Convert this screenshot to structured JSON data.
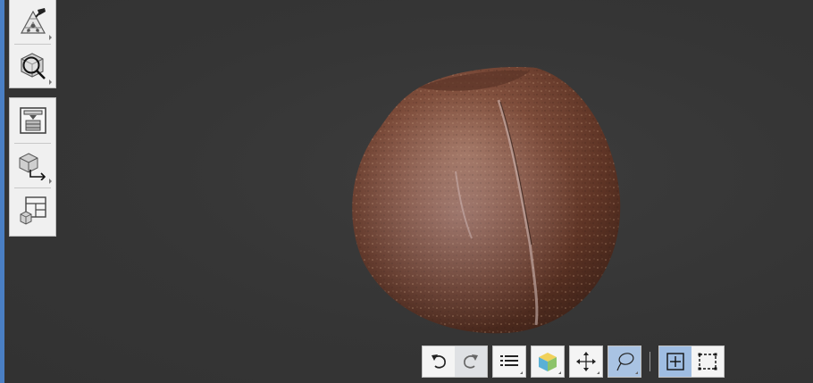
{
  "app": {
    "accent_color": "#4a7fc4",
    "viewport_background": "#353535"
  },
  "left_toolbar": {
    "panel_top": [
      {
        "icon": "mesh-paint-icon",
        "has_submenu": true
      },
      {
        "icon": "inspect-zoom-icon",
        "has_submenu": true
      }
    ],
    "panel_bottom": [
      {
        "icon": "print-layers-icon",
        "has_submenu": false
      },
      {
        "icon": "export-model-icon",
        "has_submenu": true
      },
      {
        "icon": "layout-view-icon",
        "has_submenu": false
      }
    ]
  },
  "viewport": {
    "object": "coconut-3d-model"
  },
  "bottom_toolbar": {
    "undo": {
      "icon": "undo-icon"
    },
    "redo": {
      "icon": "redo-icon",
      "state": "pressed"
    },
    "object_list": {
      "icon": "list-icon",
      "has_submenu": true
    },
    "shading": {
      "icon": "shaded-cube-icon",
      "has_submenu": true
    },
    "move": {
      "icon": "move-arrows-icon",
      "has_submenu": true
    },
    "lasso": {
      "icon": "lasso-icon",
      "state": "active",
      "has_submenu": true
    },
    "select_add": {
      "icon": "select-add-icon",
      "state": "active"
    },
    "select_rect": {
      "icon": "select-rect-icon"
    }
  }
}
